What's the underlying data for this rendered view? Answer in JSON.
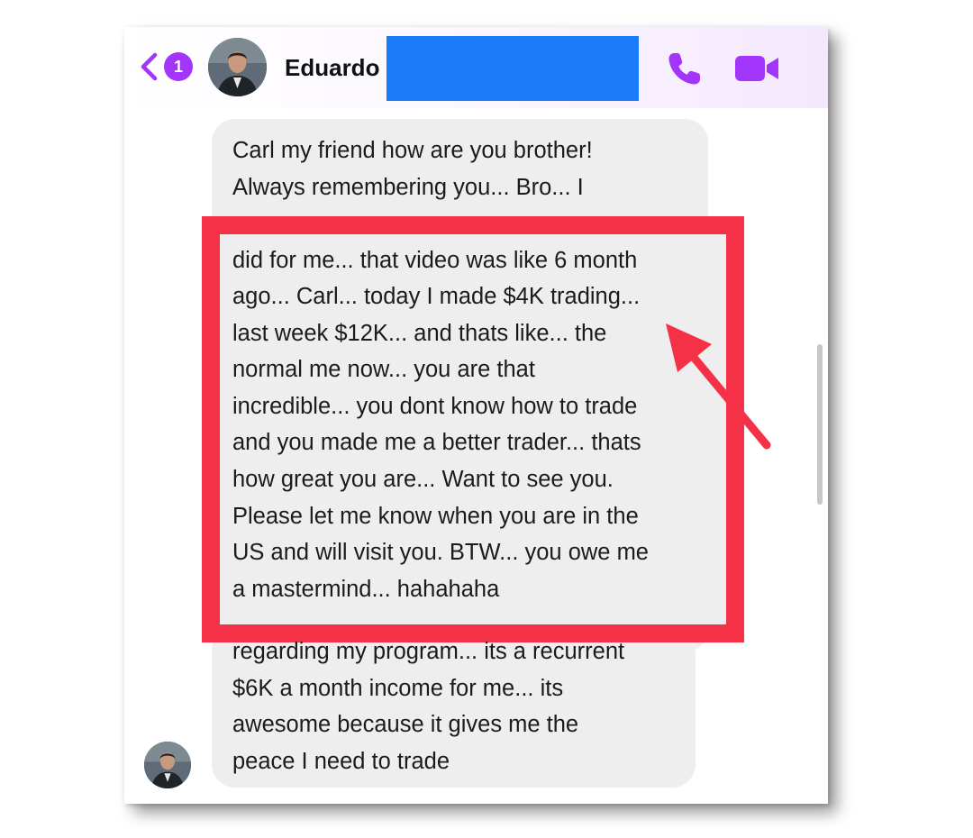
{
  "header": {
    "unread_count": "1",
    "contact_name": "Eduardo",
    "accent_color": "#a334fa",
    "icons": [
      "chevron-left-icon",
      "phone-icon",
      "video-camera-icon"
    ]
  },
  "message_top": {
    "lines": [
      "Carl my friend how are you brother!",
      "Always remembering you... Bro... I"
    ]
  },
  "message_highlighted": {
    "lines": [
      "did for me... that video was like 6 month",
      "ago... Carl... today I made $4K trading...",
      "last week $12K... and thats like... the",
      "normal me now... you are that",
      "incredible... you dont know how to trade",
      "and you made me a better trader... thats",
      "how great you are... Want to see you.",
      "Please let me know when you are in the",
      "US and will visit you. BTW... you owe me",
      "a mastermind... hahahaha"
    ],
    "highlight_color": "#f53147"
  },
  "message_bottom": {
    "lines": [
      "regarding my program... its a recurrent",
      "$6K a month  income for me... its",
      "awesome because it gives me the",
      "peace I need to trade"
    ]
  },
  "colors": {
    "bubble_bg": "#eeeeee",
    "redaction": "#1a7cf9",
    "text": "#1b1b1b"
  }
}
